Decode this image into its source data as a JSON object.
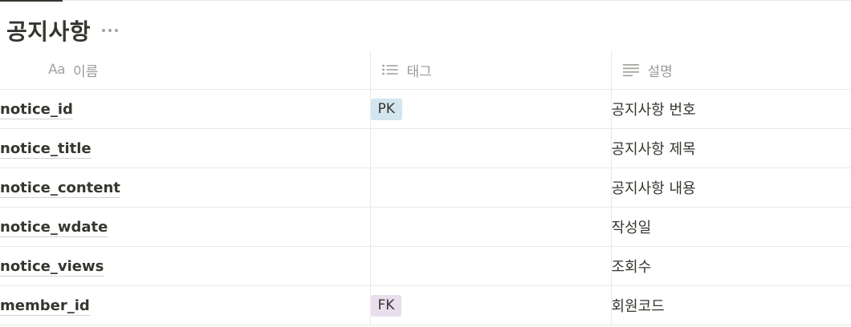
{
  "page": {
    "title": "공지사항"
  },
  "columns": {
    "name": {
      "label": "이름",
      "icon": "Aa"
    },
    "tags": {
      "label": "태그",
      "icon": "list-icon"
    },
    "description": {
      "label": "설명",
      "icon": "text-lines-icon"
    }
  },
  "rows": [
    {
      "name": "notice_id",
      "tag": "PK",
      "description": "공지사항 번호"
    },
    {
      "name": "notice_title",
      "tag": "",
      "description": "공지사항 제목"
    },
    {
      "name": "notice_content",
      "tag": "",
      "description": "공지사항 내용"
    },
    {
      "name": "notice_wdate",
      "tag": "",
      "description": "작성일"
    },
    {
      "name": "notice_views",
      "tag": "",
      "description": "조회수"
    },
    {
      "name": "member_id",
      "tag": "FK",
      "description": "회원코드"
    }
  ],
  "colors": {
    "pk_tag_bg": "#d3e5ef",
    "fk_tag_bg": "#e8deee"
  }
}
